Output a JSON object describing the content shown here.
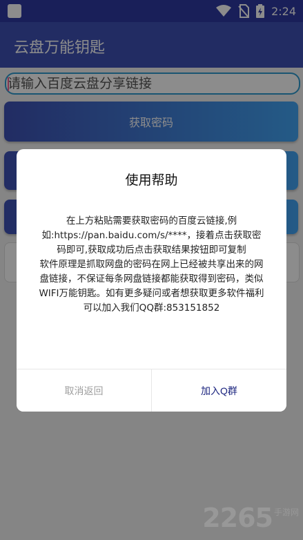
{
  "status_bar": {
    "time": "2:24",
    "icons": [
      "app-square-icon",
      "wifi-icon",
      "no-sim-icon",
      "battery-charging-icon"
    ]
  },
  "app_bar": {
    "title": "云盘万能钥匙"
  },
  "main": {
    "link_input": {
      "placeholder": "请输入百度云盘分享链接",
      "value": ""
    },
    "get_password_button": "获取密码"
  },
  "dialog": {
    "title": "使用帮助",
    "body_paragraph_1": "在上方粘贴需要获取密码的百度云链接,例如:https://pan.baidu.com/s/****，接着点击获取密码即可,获取成功后点击获取结果按钮即可复制",
    "body_paragraph_2": "软件原理是抓取网盘的密码在网上已经被共享出来的网盘链接，不保证每条网盘链接都能获取得到密码，类似WIFI万能钥匙。如有更多疑问或者想获取更多软件福利可以加入我们QQ群:853151852",
    "cancel_label": "取消返回",
    "confirm_label": "加入Q群"
  },
  "watermark": {
    "number": "2265",
    "sub": "手游网"
  },
  "colors": {
    "status_bar": "#2f3aa3",
    "app_bar": "#3f51b5",
    "gradient_start": "#3f51b5",
    "gradient_end": "#42a5f5",
    "confirm_text": "#1a237e"
  }
}
